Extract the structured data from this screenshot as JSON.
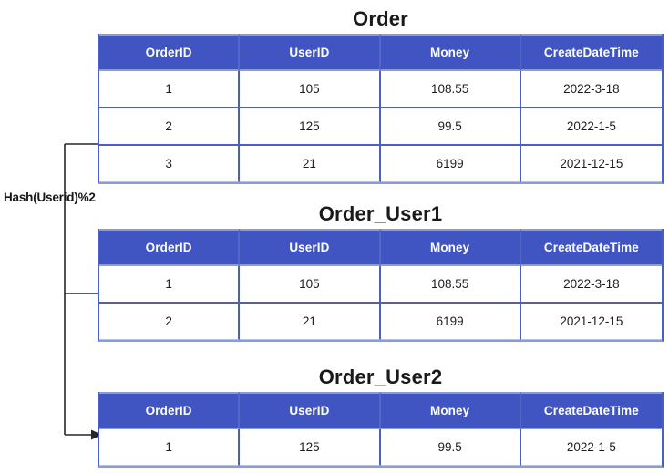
{
  "diagram": {
    "title_label": "Hash(Userid)%2",
    "accent_color": "#4054c2",
    "border_color": "#4a5fc6",
    "header_text_color": "#ffffff",
    "background_color": "#ffffff"
  },
  "columns": [
    "OrderID",
    "UserID",
    "Money",
    "CreateDateTime"
  ],
  "tables": [
    {
      "name": "Order",
      "columns": [
        "OrderID",
        "UserID",
        "Money",
        "CreateDateTime"
      ],
      "rows": [
        [
          "1",
          "105",
          "108.55",
          "2022-3-18"
        ],
        [
          "2",
          "125",
          "99.5",
          "2022-1-5"
        ],
        [
          "3",
          "21",
          "6199",
          "2021-12-15"
        ]
      ]
    },
    {
      "name": "Order_User1",
      "columns": [
        "OrderID",
        "UserID",
        "Money",
        "CreateDateTime"
      ],
      "rows": [
        [
          "1",
          "105",
          "108.55",
          "2022-3-18"
        ],
        [
          "2",
          "21",
          "6199",
          "2021-12-15"
        ]
      ]
    },
    {
      "name": "Order_User2",
      "columns": [
        "OrderID",
        "UserID",
        "Money",
        "CreateDateTime"
      ],
      "rows": [
        [
          "1",
          "125",
          "99.5",
          "2022-1-5"
        ]
      ]
    }
  ]
}
